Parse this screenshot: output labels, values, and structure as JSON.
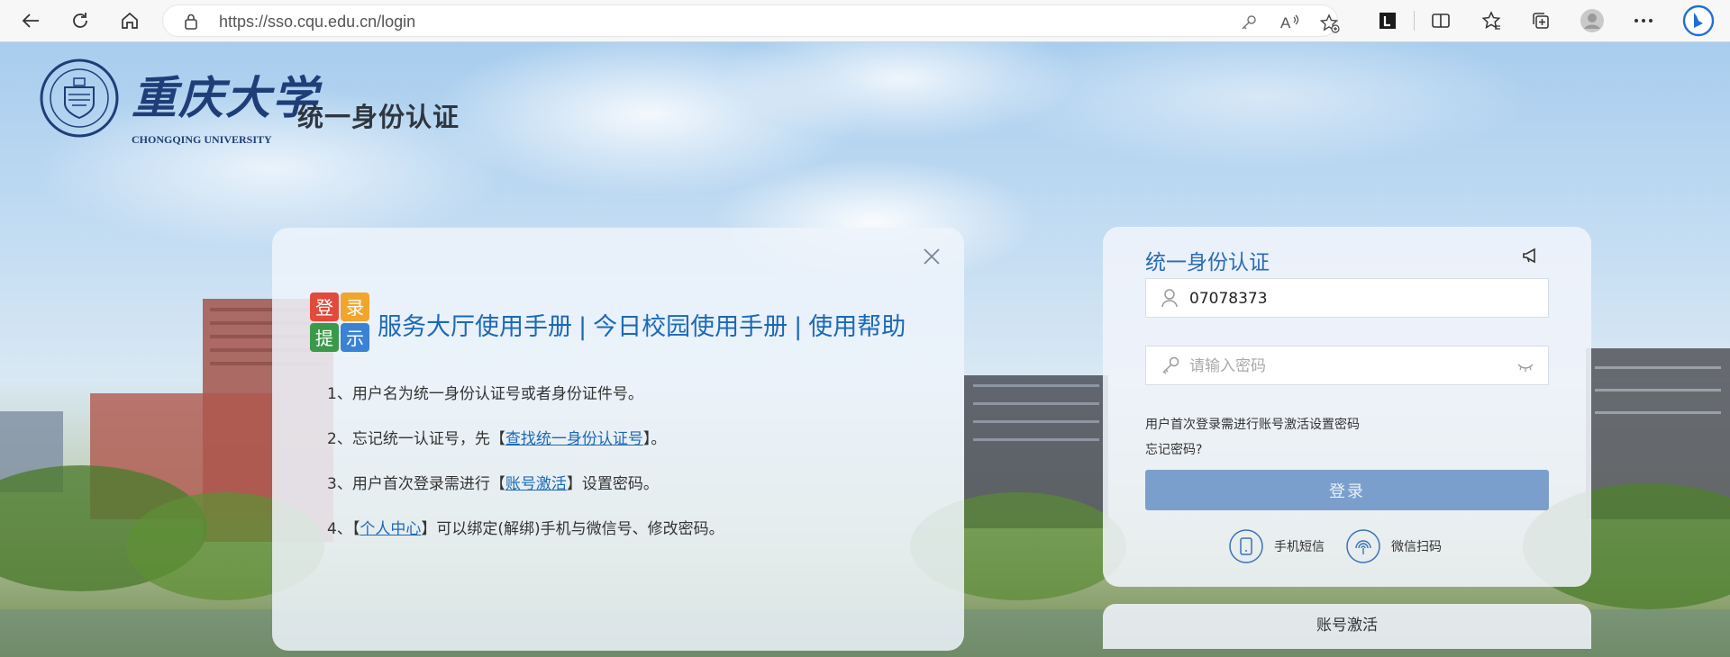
{
  "browser": {
    "url": "https://sso.cqu.edu.cn/login",
    "icons": [
      "back-icon",
      "refresh-icon",
      "home-icon",
      "lock-icon",
      "key-icon",
      "read-aloud-icon",
      "add-favorite-icon",
      "extension-l-icon",
      "split-screen-icon",
      "favorites-icon",
      "collections-icon",
      "profile-icon",
      "more-icon",
      "bing-icon"
    ]
  },
  "header": {
    "university_cn": "重庆大学",
    "university_en": "CHONGQING UNIVERSITY",
    "system_name": "统一身份认证"
  },
  "notice": {
    "badge_chars": [
      "登",
      "录",
      "提",
      "示"
    ],
    "link_manual": "服务大厅使用手册",
    "link_today": "今日校园使用手册",
    "link_help": "使用帮助",
    "separator": "|",
    "tips": [
      {
        "prefix": "1、用户名为统一身份认证号或者身份证件号。",
        "link": "",
        "suffix": ""
      },
      {
        "prefix": "2、忘记统一认证号，先【",
        "link": "查找统一身份认证号",
        "suffix": "】。"
      },
      {
        "prefix": "3、用户首次登录需进行【",
        "link": "账号激活",
        "suffix": "】设置密码。"
      },
      {
        "prefix": "4、【",
        "link": "个人中心",
        "suffix": "】可以绑定(解绑)手机与微信号、修改密码。"
      }
    ]
  },
  "login": {
    "title": "统一身份认证",
    "username_value": "07078373",
    "password_placeholder": "请输入密码",
    "hint_activate": "用户首次登录需进行账号激活设置密码",
    "forgot_password": "忘记密码?",
    "submit_label": "登录",
    "sms_label": "手机短信",
    "wechat_label": "微信扫码",
    "activate_label": "账号激活"
  },
  "colors": {
    "accent_blue": "#2a6bb5",
    "button_blue": "#7b9fcd",
    "link_blue": "#1a69b8",
    "brand_navy": "#1f3e78"
  }
}
